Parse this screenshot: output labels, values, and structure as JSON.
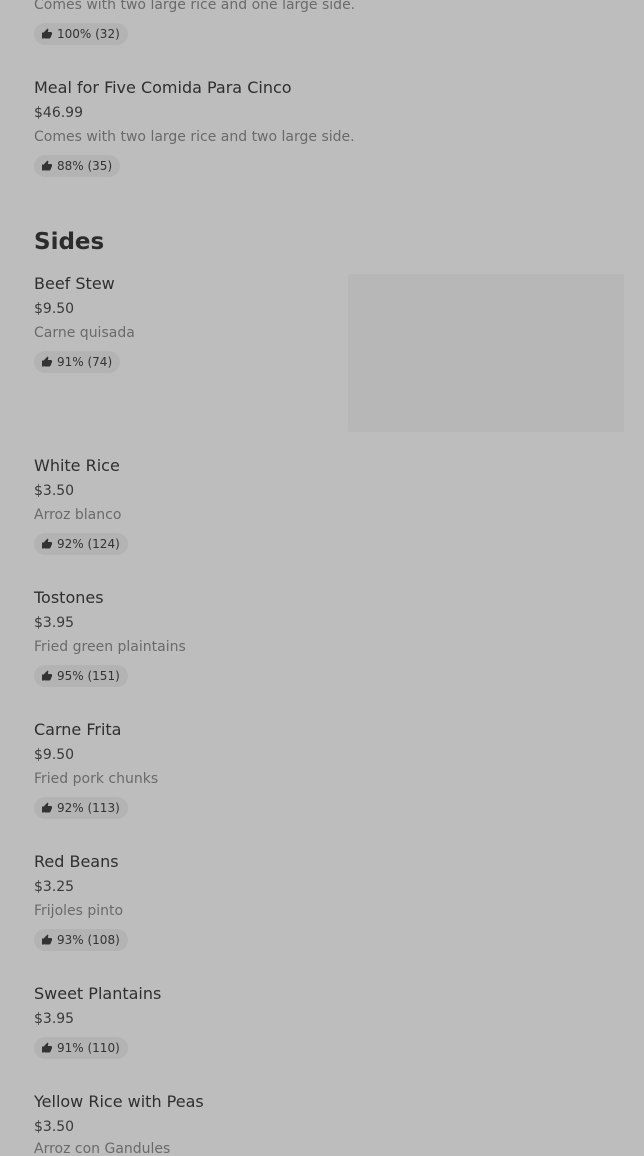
{
  "items_top": [
    {
      "desc": "Comes with two large rice and one large side.",
      "rating": "100% (32)"
    },
    {
      "name": "Meal for Five Comida Para Cinco",
      "price": "$46.99",
      "desc": "Comes with two large rice and two large side.",
      "rating": "88% (35)"
    }
  ],
  "sides": {
    "title": "Sides",
    "items": [
      {
        "name": "Beef Stew",
        "price": "$9.50",
        "desc": "Carne quisada",
        "rating": "91% (74)"
      },
      {
        "name": "White Rice",
        "price": "$3.50",
        "desc": "Arroz blanco",
        "rating": "92% (124)"
      },
      {
        "name": "Tostones",
        "price": "$3.95",
        "desc": "Fried green plaintains",
        "rating": "95% (151)"
      },
      {
        "name": "Carne Frita",
        "price": "$9.50",
        "desc": "Fried pork chunks",
        "rating": "92% (113)"
      },
      {
        "name": "Red Beans",
        "price": "$3.25",
        "desc": "Frijoles pinto",
        "rating": "93% (108)"
      },
      {
        "name": "Sweet Plantains",
        "price": "$3.95",
        "rating": "91% (110)"
      },
      {
        "name": "Yellow Rice with Peas",
        "price": "$3.50",
        "desc": "Arroz con Gandules"
      }
    ]
  },
  "icons": {
    "rating": "thumbs-up-icon"
  }
}
